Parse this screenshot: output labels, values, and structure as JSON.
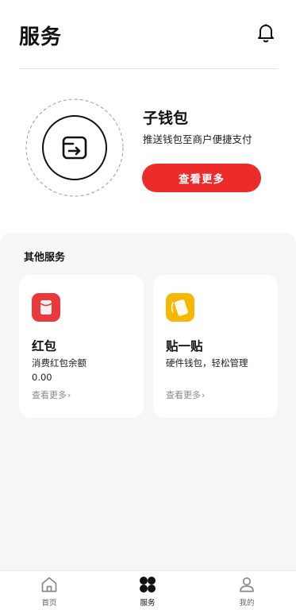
{
  "header": {
    "title": "服务"
  },
  "hero": {
    "title": "子钱包",
    "subtitle": "推送钱包至商户便捷支付",
    "button_label": "查看更多"
  },
  "other_services": {
    "title": "其他服务",
    "cards": [
      {
        "title": "红包",
        "desc": "消费红包余额",
        "value": "0.00",
        "more": "查看更多",
        "icon": "red-packet-icon",
        "color": "#e8393c"
      },
      {
        "title": "贴一贴",
        "desc": "硬件钱包，轻松管理",
        "more": "查看更多",
        "icon": "tap-card-icon",
        "color": "#f5b800"
      }
    ]
  },
  "tabbar": {
    "tabs": [
      {
        "label": "首页",
        "icon": "home-icon",
        "active": false
      },
      {
        "label": "服务",
        "icon": "services-grid-icon",
        "active": true
      },
      {
        "label": "我的",
        "icon": "profile-icon",
        "active": false
      }
    ]
  },
  "colors": {
    "accent": "#ee2b2b",
    "background_section": "#f5f6f8"
  }
}
